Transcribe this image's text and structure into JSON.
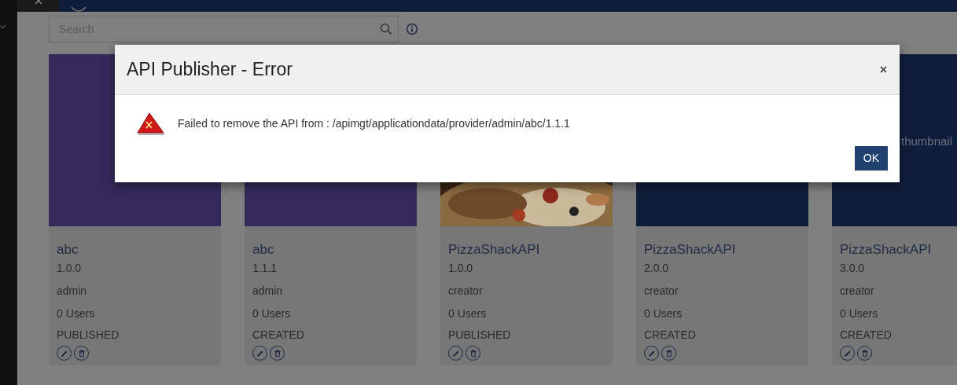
{
  "search": {
    "placeholder": "Search"
  },
  "cards": [
    {
      "thumbnail": {
        "kind": "color",
        "color": "#342a5c"
      },
      "name": "abc",
      "version": "1.0.0",
      "owner": "admin",
      "users": "0 Users",
      "status": "PUBLISHED"
    },
    {
      "thumbnail": {
        "kind": "color",
        "color": "#342a5c"
      },
      "name": "abc",
      "version": "1.1.1",
      "owner": "admin",
      "users": "0 Users",
      "status": "CREATED"
    },
    {
      "name": "PizzaShackAPI",
      "version": "1.0.0",
      "owner": "creator",
      "users": "0 Users",
      "status": "PUBLISHED"
    },
    {
      "thumbnail": {
        "kind": "color",
        "color": "#0f1e3a"
      },
      "name": "PizzaShackAPI",
      "version": "2.0.0",
      "owner": "creator",
      "users": "0 Users",
      "status": "CREATED"
    },
    {
      "thumbnail": {
        "kind": "color",
        "color": "#0f1e3a",
        "text": "thumbnail"
      },
      "name": "PizzaShackAPI",
      "version": "3.0.0",
      "owner": "creator",
      "users": "0 Users",
      "status": "CREATED"
    }
  ],
  "dialog": {
    "title": "API Publisher - Error",
    "close": "×",
    "message": "Failed to remove the API from : /apimgt/applicationdata/provider/admin/abc/1.1.1",
    "ok": "OK"
  }
}
